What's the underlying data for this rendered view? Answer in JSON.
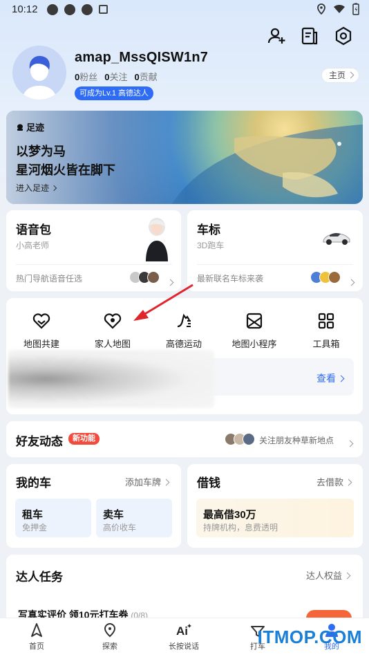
{
  "status_bar": {
    "time": "10:12"
  },
  "profile": {
    "username": "amap_MssQISW1n7",
    "fans_count": "0",
    "fans_label": "粉丝",
    "follow_count": "0",
    "follow_label": "关注",
    "contrib_count": "0",
    "contrib_label": "贡献",
    "level_badge": "可成为Lv.1 高德达人",
    "homepage_label": "主页"
  },
  "banner": {
    "tag": "足迹",
    "title_line1": "以梦为马",
    "title_line2": "星河烟火皆在脚下",
    "link": "进入足迹"
  },
  "voice_card": {
    "title": "语音包",
    "subtitle": "小高老师",
    "footer": "热门导航语音任选"
  },
  "car_icon_card": {
    "title": "车标",
    "subtitle": "3D跑车",
    "footer": "最新联名车标来袭"
  },
  "tools": [
    {
      "label": "地图共建",
      "icon": "heart-map-icon"
    },
    {
      "label": "家人地图",
      "icon": "family-map-icon"
    },
    {
      "label": "高德运动",
      "icon": "running-shoe-icon"
    },
    {
      "label": "地图小程序",
      "icon": "mini-program-icon"
    },
    {
      "label": "工具箱",
      "icon": "grid-icon"
    }
  ],
  "view_link": "查看",
  "friends": {
    "title": "好友动态",
    "badge": "新功能",
    "hint": "关注朋友种草新地点"
  },
  "my_car": {
    "title": "我的车",
    "action": "添加车牌",
    "rent_title": "租车",
    "rent_sub": "免押金",
    "sell_title": "卖车",
    "sell_sub": "高价收车"
  },
  "loan": {
    "title": "借钱",
    "action": "去借款",
    "box_title": "最高借30万",
    "box_sub": "持牌机构，息费透明"
  },
  "expert_tasks": {
    "title": "达人任务",
    "action": "达人权益",
    "task_text": "写真实评价 领10元打车券",
    "task_progress": "(0/8)"
  },
  "bottom_nav": [
    {
      "label": "首页",
      "icon": "navigate-arrow-icon"
    },
    {
      "label": "探索",
      "icon": "location-pin-icon"
    },
    {
      "label": "长按说话",
      "icon": "ai-voice-icon"
    },
    {
      "label": "打车",
      "icon": "taxi-icon"
    },
    {
      "label": "我的",
      "icon": "person-icon"
    }
  ],
  "watermark": "ITMOP.COM",
  "colors": {
    "accent": "#2e6cf6",
    "badge_red": "#f04b3c",
    "arrow_red": "#e0262d",
    "watermark": "#1a7fd6"
  }
}
